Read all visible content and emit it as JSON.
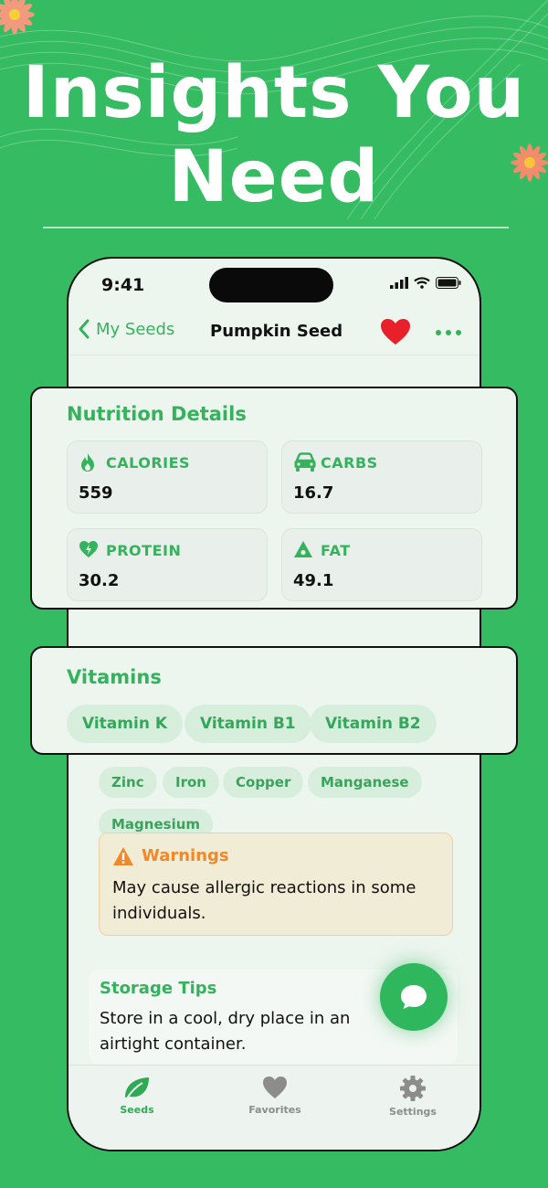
{
  "headline": {
    "line1": "Insights You",
    "line2": "Need"
  },
  "status_bar": {
    "time": "9:41"
  },
  "nav": {
    "back_label": "My Seeds",
    "title": "Pumpkin Seed"
  },
  "nutrition": {
    "title": "Nutrition Details",
    "items": [
      {
        "label": "CALORIES",
        "value": "559",
        "icon": "flame-icon"
      },
      {
        "label": "CARBS",
        "value": "16.7",
        "icon": "car-icon"
      },
      {
        "label": "PROTEIN",
        "value": "30.2",
        "icon": "heart-bolt-icon"
      },
      {
        "label": "FAT",
        "value": "49.1",
        "icon": "triangle-drop-icon"
      }
    ]
  },
  "vitamins": {
    "title": "Vitamins",
    "items": [
      "Vitamin K",
      "Vitamin B1",
      "Vitamin B2"
    ]
  },
  "minerals": {
    "items": [
      "Zinc",
      "Iron",
      "Copper",
      "Manganese",
      "Magnesium"
    ]
  },
  "warnings": {
    "title": "Warnings",
    "text": "May cause allergic reactions in some individuals."
  },
  "storage": {
    "title": "Storage Tips",
    "text": "Store in a cool, dry place in an airtight container."
  },
  "tabs": [
    {
      "label": "Seeds",
      "icon": "leaf-icon",
      "active": true
    },
    {
      "label": "Favorites",
      "icon": "heart-icon",
      "active": false
    },
    {
      "label": "Settings",
      "icon": "gear-icon",
      "active": false
    }
  ],
  "colors": {
    "background": "#35bb62",
    "accent": "#34b25c",
    "warning": "#f0892b",
    "heart": "#e8202a"
  }
}
